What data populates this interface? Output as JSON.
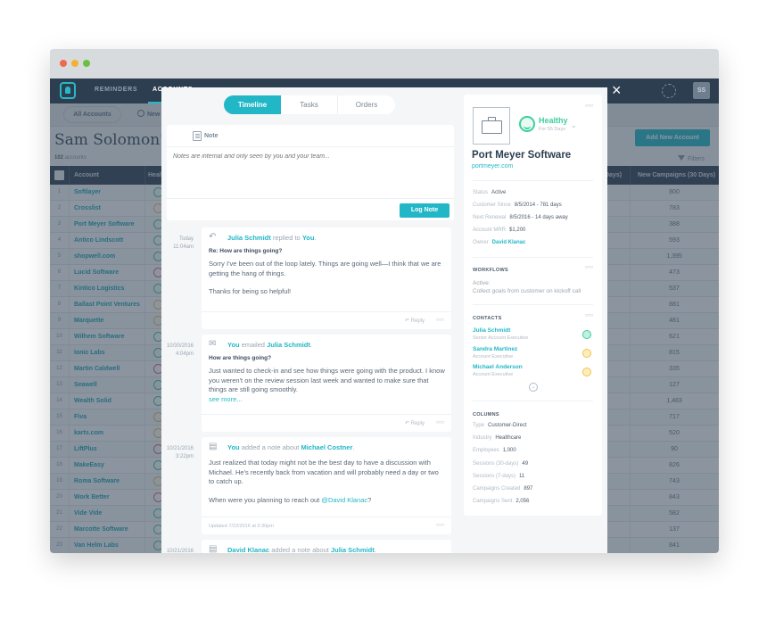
{
  "window": {
    "traffic_lights": [
      "close",
      "minimize",
      "maximize"
    ]
  },
  "navbar": {
    "items": [
      {
        "label": "REMINDERS"
      },
      {
        "label": "ACCOUNTS"
      }
    ],
    "close_icon": "×",
    "avatar_initials": "SS"
  },
  "subbar": {
    "all_accounts_label": "All Accounts",
    "new_label": "New"
  },
  "page": {
    "title": "Sam Solomon's Accounts",
    "count_value": "102",
    "count_label": "accounts",
    "add_button_label": "Add New Account",
    "filters_label": "Filters"
  },
  "table": {
    "columns": {
      "account": "Account",
      "health": "Health",
      "campaigns_partial": "Days)",
      "new_campaigns": "New Campaigns (30 Days)"
    },
    "rows": [
      {
        "num": "1",
        "name": "Softlayer",
        "health": "green",
        "campaigns": "800"
      },
      {
        "num": "2",
        "name": "Crosslist",
        "health": "yellow",
        "campaigns": "783"
      },
      {
        "num": "3",
        "name": "Port Meyer Software",
        "health": "green",
        "campaigns": "388"
      },
      {
        "num": "4",
        "name": "Antico Lindscott",
        "health": "green",
        "campaigns": "593"
      },
      {
        "num": "5",
        "name": "shopwell.com",
        "health": "green",
        "campaigns": "1,395"
      },
      {
        "num": "6",
        "name": "Lucid Software",
        "health": "red",
        "campaigns": "473"
      },
      {
        "num": "7",
        "name": "Kintico Logistics",
        "health": "green",
        "campaigns": "537"
      },
      {
        "num": "8",
        "name": "Ballast Point Ventures",
        "health": "yellow",
        "campaigns": "881"
      },
      {
        "num": "9",
        "name": "Marquette",
        "health": "yellow",
        "campaigns": "481"
      },
      {
        "num": "10",
        "name": "Wilhem Software",
        "health": "green",
        "campaigns": "621"
      },
      {
        "num": "11",
        "name": "Ionic Labs",
        "health": "green",
        "campaigns": "815"
      },
      {
        "num": "12",
        "name": "Martin Caldwell",
        "health": "red",
        "campaigns": "335"
      },
      {
        "num": "13",
        "name": "Seawell",
        "health": "green",
        "campaigns": "127"
      },
      {
        "num": "14",
        "name": "Wealth Solid",
        "health": "green",
        "campaigns": "1,483"
      },
      {
        "num": "15",
        "name": "Fiva",
        "health": "yellow",
        "campaigns": "717"
      },
      {
        "num": "16",
        "name": "karts.com",
        "health": "yellow",
        "campaigns": "520"
      },
      {
        "num": "17",
        "name": "LiftPlus",
        "health": "red",
        "campaigns": "90"
      },
      {
        "num": "18",
        "name": "MakeEasy",
        "health": "green",
        "campaigns": "826"
      },
      {
        "num": "19",
        "name": "Roma Software",
        "health": "yellow",
        "campaigns": "743"
      },
      {
        "num": "20",
        "name": "Work Better",
        "health": "red",
        "campaigns": "843"
      },
      {
        "num": "21",
        "name": "Vide Vide",
        "health": "green",
        "campaigns": "582"
      },
      {
        "num": "22",
        "name": "Marcotte Software",
        "health": "green",
        "campaigns": "137"
      },
      {
        "num": "23",
        "name": "Van Helm Labs",
        "health": "green",
        "campaigns": "841"
      }
    ]
  },
  "colors": {
    "accent": "#22b7c7",
    "health_green": "#3dcf9c",
    "health_yellow": "#f6c04c",
    "health_red": "#e46b6b",
    "navbar": "#2d3e50"
  },
  "modal": {
    "tabs": [
      {
        "label": "Timeline",
        "active": true
      },
      {
        "label": "Tasks",
        "active": false
      },
      {
        "label": "Orders",
        "active": false
      }
    ],
    "note": {
      "label": "Note",
      "placeholder": "Notes are internal and only seen by you and your team...",
      "value": "",
      "submit_label": "Log Note"
    },
    "timeline": [
      {
        "date": "Today",
        "time": "11:04am",
        "icon": "reply-icon",
        "actor": "Julia Schmidt",
        "verb": "replied to",
        "target": "You",
        "subject": "Re: How are things going?",
        "body": [
          "Sorry I've been out of the loop lately. Things are going well—I think that we are getting the hang of things.",
          "Thanks for being so helpful!"
        ],
        "reply_label": "Reply"
      },
      {
        "date": "10/30/2016",
        "time": "4:04pm",
        "icon": "mail-icon",
        "actor": "You",
        "verb": "emailed",
        "target": "Julia Schmidt",
        "subject": "How are things going?",
        "body": [
          "Just wanted to check-in and see how things were going with the product. I know you weren't on the review session last week and wanted to make sure that things are still going smoothly."
        ],
        "see_more": "see more...",
        "reply_label": "Reply"
      },
      {
        "date": "10/21/2016",
        "time": "3:22pm",
        "icon": "note-icon",
        "actor": "You",
        "verb": "added a note about",
        "target": "Michael Costner",
        "body_1": "Just realized that today might not be the best day to have a discussion with Michael. He's recently back from vacation and will probably need a day or two to catch up.",
        "body_2_prefix": "When were you planning to reach out ",
        "body_2_mention": "@David Klanac",
        "body_2_suffix": "?",
        "updated": "Updated 7/22/2016 at 3:30pm"
      },
      {
        "date": "10/21/2016",
        "icon": "note-icon",
        "actor": "David Klanac",
        "verb": "added a note about",
        "target": "Julia Schmidt"
      }
    ]
  },
  "sidebar": {
    "health": {
      "label": "Healthy",
      "duration": "For 55 Days"
    },
    "company": {
      "name": "Port Meyer Software",
      "url": "portmeyer.com"
    },
    "details": [
      {
        "key": "Status",
        "value": "Active"
      },
      {
        "key": "Customer Since",
        "value": "8/5/2014 - 781 days"
      },
      {
        "key": "Next Renewal",
        "value": "8/5/2016 - 14 days away"
      },
      {
        "key": "Account MRR",
        "value": "$1,200"
      },
      {
        "key": "Owner",
        "value": "David Klanac"
      }
    ],
    "workflows": {
      "title": "WORKFLOWS",
      "active_label": "Active:",
      "description": "Collect goals from customer on kickoff call"
    },
    "contacts": {
      "title": "CONTACTS",
      "items": [
        {
          "name": "Julia Schmidt",
          "role": "Senior Account Executive",
          "health": "green"
        },
        {
          "name": "Sandra Martinez",
          "role": "Account Executive",
          "health": "yellow"
        },
        {
          "name": "Michael Anderson",
          "role": "Account Executive",
          "health": "yellow"
        }
      ]
    },
    "columns": {
      "title": "COLUMNS",
      "items": [
        {
          "key": "Type",
          "value": "Customer-Direct"
        },
        {
          "key": "Industry",
          "value": "Healthcare"
        },
        {
          "key": "Employees",
          "value": "1,000"
        },
        {
          "key": "Sessions (30-days)",
          "value": "49"
        },
        {
          "key": "Sessions (7-days)",
          "value": "11"
        },
        {
          "key": "Campaigns Created",
          "value": "897"
        },
        {
          "key": "Campaigns Sent",
          "value": "2,056"
        }
      ]
    }
  }
}
